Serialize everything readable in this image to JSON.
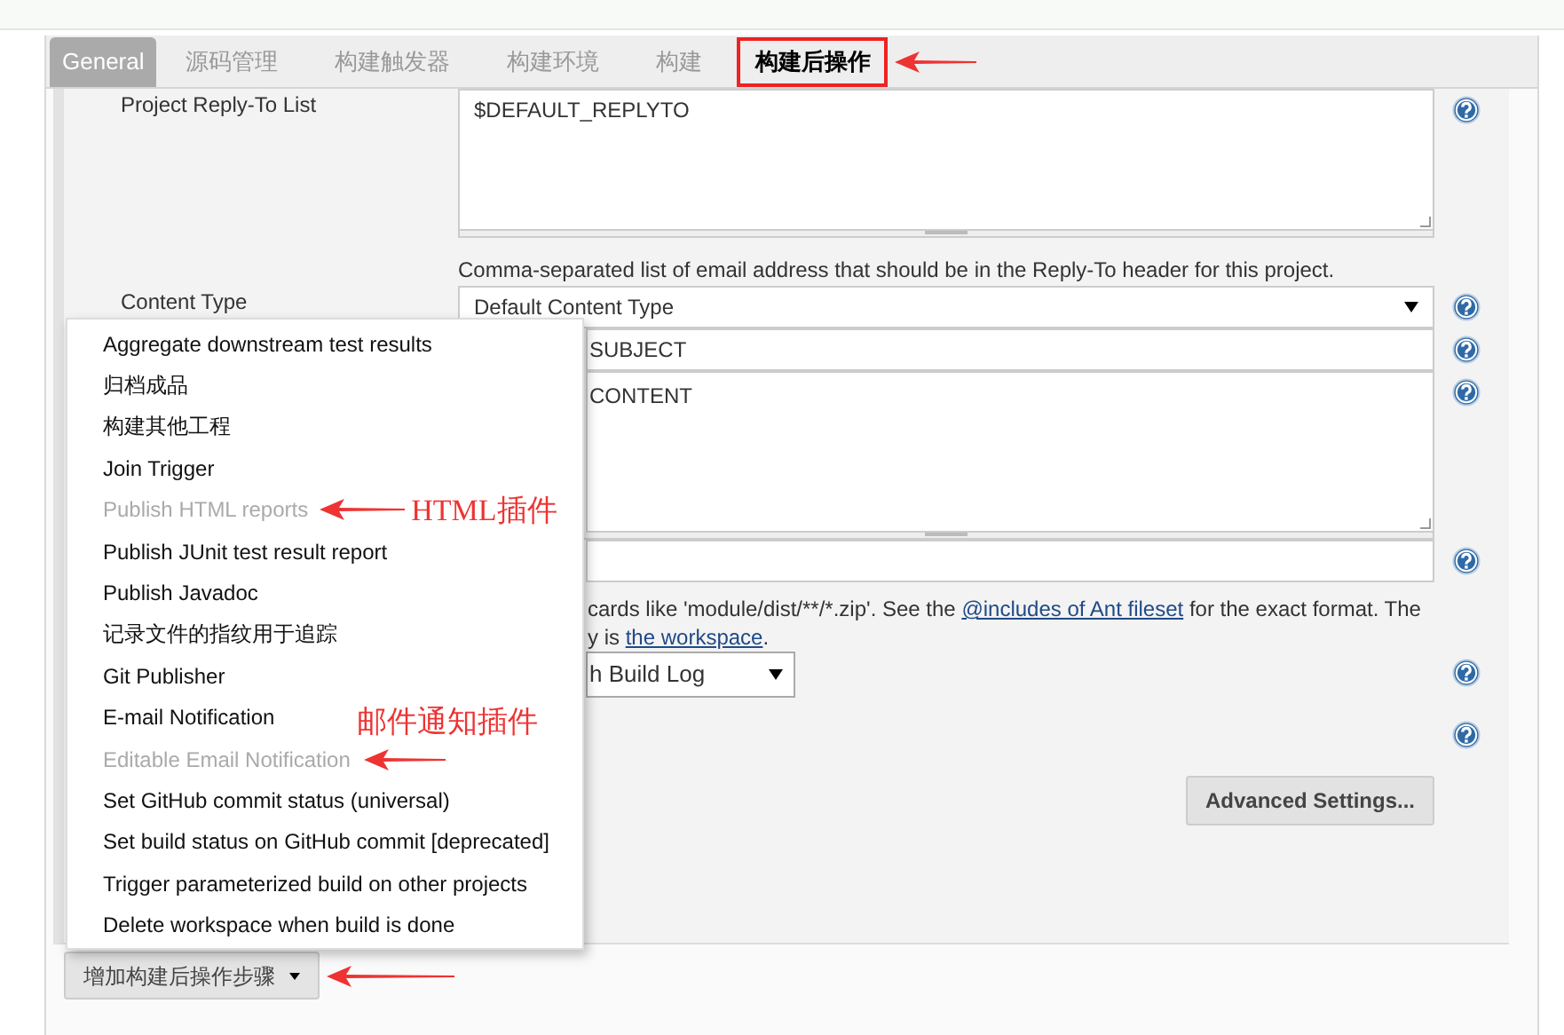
{
  "tabs": [
    {
      "label": "General",
      "selected": true,
      "annotated": false
    },
    {
      "label": "源码管理",
      "selected": false,
      "annotated": false
    },
    {
      "label": "构建触发器",
      "selected": false,
      "annotated": false
    },
    {
      "label": "构建环境",
      "selected": false,
      "annotated": false
    },
    {
      "label": "构建",
      "selected": false,
      "annotated": false
    },
    {
      "label": "构建后操作",
      "selected": false,
      "annotated": true
    }
  ],
  "form": {
    "reply_to": {
      "label": "Project Reply-To List",
      "value": "$DEFAULT_REPLYTO",
      "help": "Comma-separated list of email address that should be in the Reply-To header for this project."
    },
    "content_type": {
      "label": "Content Type",
      "value": "Default Content Type"
    },
    "subject": {
      "value": "SUBJECT"
    },
    "content": {
      "value": "CONTENT"
    },
    "attachments_help": [
      [
        {
          "kind": "text",
          "text": "cards like 'module/dist/**/*.zip'. See the "
        },
        {
          "kind": "link",
          "text": "@includes of Ant fileset"
        },
        {
          "kind": "text",
          "text": " for the exact format. The"
        }
      ],
      [
        {
          "kind": "text",
          "text": "y is "
        },
        {
          "kind": "link",
          "text": "the workspace"
        },
        {
          "kind": "text",
          "text": "."
        }
      ]
    ],
    "build_log": {
      "value": "h Build Log"
    },
    "advanced_button": "Advanced Settings..."
  },
  "menu": [
    {
      "label": "Aggregate downstream test results",
      "disabled": false
    },
    {
      "label": "归档成品",
      "disabled": false
    },
    {
      "label": "构建其他工程",
      "disabled": false
    },
    {
      "label": "Join Trigger",
      "disabled": false
    },
    {
      "label": "Publish HTML reports",
      "disabled": true,
      "annotation": {
        "kind": "right",
        "text": "HTML插件"
      }
    },
    {
      "label": "Publish JUnit test result report",
      "disabled": false
    },
    {
      "label": "Publish Javadoc",
      "disabled": false
    },
    {
      "label": "记录文件的指纹用于追踪",
      "disabled": false
    },
    {
      "label": "Git Publisher",
      "disabled": false
    },
    {
      "label": "E-mail Notification",
      "disabled": false
    },
    {
      "label": "Editable Email Notification",
      "disabled": true,
      "annotation": {
        "kind": "above",
        "text": "邮件通知插件"
      }
    },
    {
      "label": "Set GitHub commit status (universal)",
      "disabled": false
    },
    {
      "label": "Set build status on GitHub commit [deprecated]",
      "disabled": false
    },
    {
      "label": "Trigger parameterized build on other projects",
      "disabled": false
    },
    {
      "label": "Delete workspace when build is done",
      "disabled": false
    }
  ],
  "add_step_button": {
    "label": "增加构建后操作步骤",
    "annotated": true
  }
}
